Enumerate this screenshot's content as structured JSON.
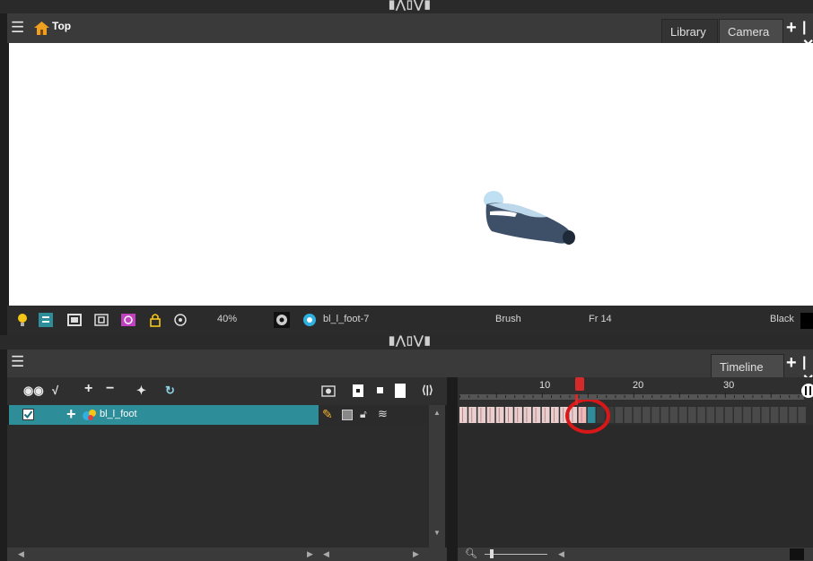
{
  "grips": {
    "top": "▮⋀▯⋁▮",
    "mid": "▮⋀▯⋁▮"
  },
  "camera_view": {
    "title": "Top",
    "tabs": [
      {
        "label": "Library"
      },
      {
        "label": "Camera"
      }
    ],
    "toolbar": {
      "zoom": "40%",
      "drawing_name": "bl_l_foot-7",
      "tool": "Brush",
      "frame": "Fr 14",
      "color_name": "Black"
    }
  },
  "timeline_view": {
    "tab": {
      "label": "Timeline"
    },
    "layers": [
      {
        "name": "bl_l_foot",
        "checked": true
      }
    ],
    "ruler": {
      "ticks": [
        "10",
        "20",
        "30"
      ]
    },
    "current_frame": 14
  },
  "icons": {
    "menu": "hamburger-menu-icon",
    "home": "house-icon",
    "add": "plus-icon",
    "close": "close-icon"
  },
  "colors": {
    "layer_selected": "#2d8d99",
    "playhead": "#d62a2a",
    "highlight_circle": "#d81818",
    "stage": "#ffffff"
  }
}
